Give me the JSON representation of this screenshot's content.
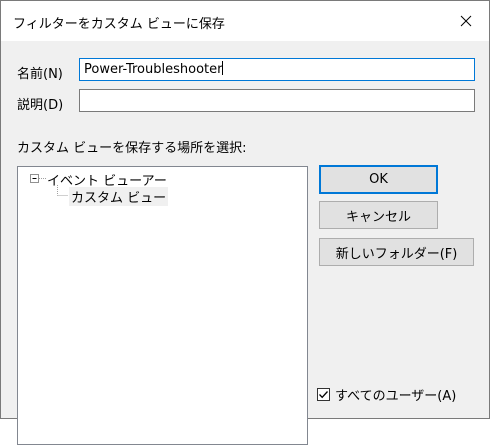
{
  "dialog": {
    "title": "フィルターをカスタム ビューに保存"
  },
  "fields": {
    "name_label": "名前(N)",
    "name_value": "Power-Troubleshooter",
    "description_label": "説明(D)",
    "description_value": ""
  },
  "location": {
    "label": "カスタム ビューを保存する場所を選択:",
    "tree": {
      "root": "イベント ビューアー",
      "child": "カスタム ビュー"
    }
  },
  "buttons": {
    "ok": "OK",
    "cancel": "キャンセル",
    "new_folder": "新しいフォルダー(F)"
  },
  "all_users": {
    "label": "すべてのユーザー(A)",
    "checked": true
  }
}
